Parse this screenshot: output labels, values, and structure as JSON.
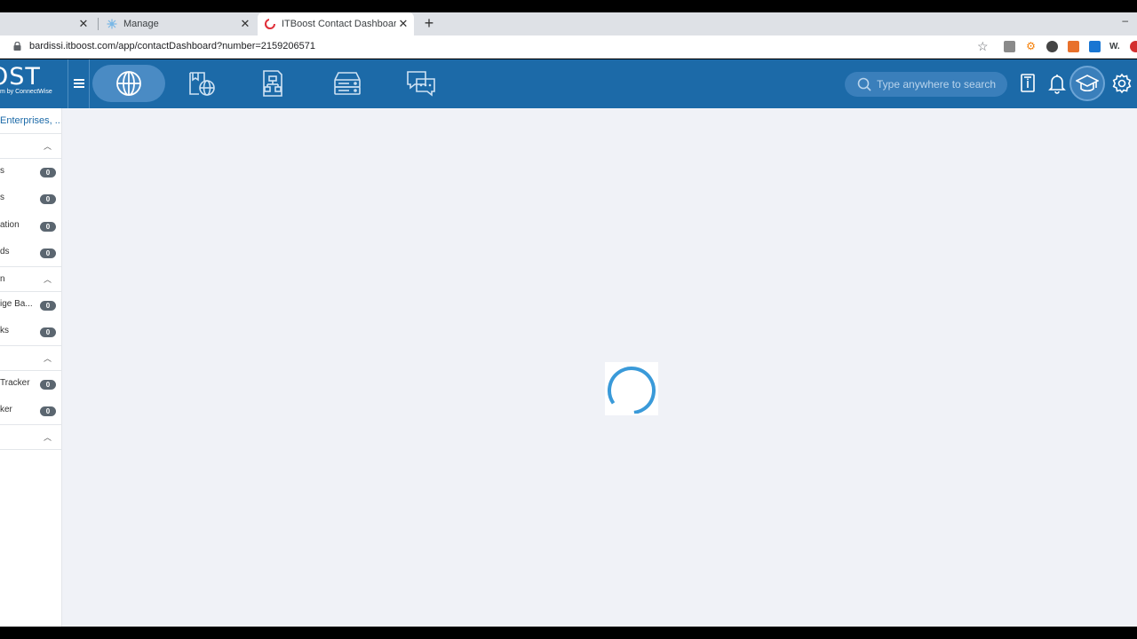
{
  "browser": {
    "tabs": [
      {
        "label": ""
      },
      {
        "label": "Manage"
      },
      {
        "label": "ITBoost Contact Dashboard"
      }
    ],
    "url": "bardissi.itboost.com/app/contactDashboard?number=2159206571",
    "window_min": "–"
  },
  "header": {
    "logo_text": "OST",
    "logo_sub": "m by ConnectWise",
    "search_placeholder": "Type anywhere to search"
  },
  "sidebar": {
    "org": "Enterprises, ...",
    "sections": [
      {
        "label": "",
        "items": [
          {
            "label": "s",
            "count": "0"
          },
          {
            "label": "s",
            "count": "0"
          },
          {
            "label": "ation",
            "count": "0"
          },
          {
            "label": "ds",
            "count": "0"
          }
        ]
      },
      {
        "label": "n",
        "items": [
          {
            "label": "ige Ba...",
            "count": "0"
          },
          {
            "label": "ks",
            "count": "0"
          }
        ]
      },
      {
        "label": "",
        "items": [
          {
            "label": " Tracker",
            "count": "0"
          },
          {
            "label": "ker",
            "count": "0"
          }
        ]
      },
      {
        "label": "",
        "items": []
      }
    ]
  },
  "colors": {
    "header_bg": "#1c6aa8",
    "main_bg": "#f0f2f7",
    "spinner": "#3a9ad9",
    "badge": "#5b6670"
  },
  "main": {
    "state": "loading"
  }
}
